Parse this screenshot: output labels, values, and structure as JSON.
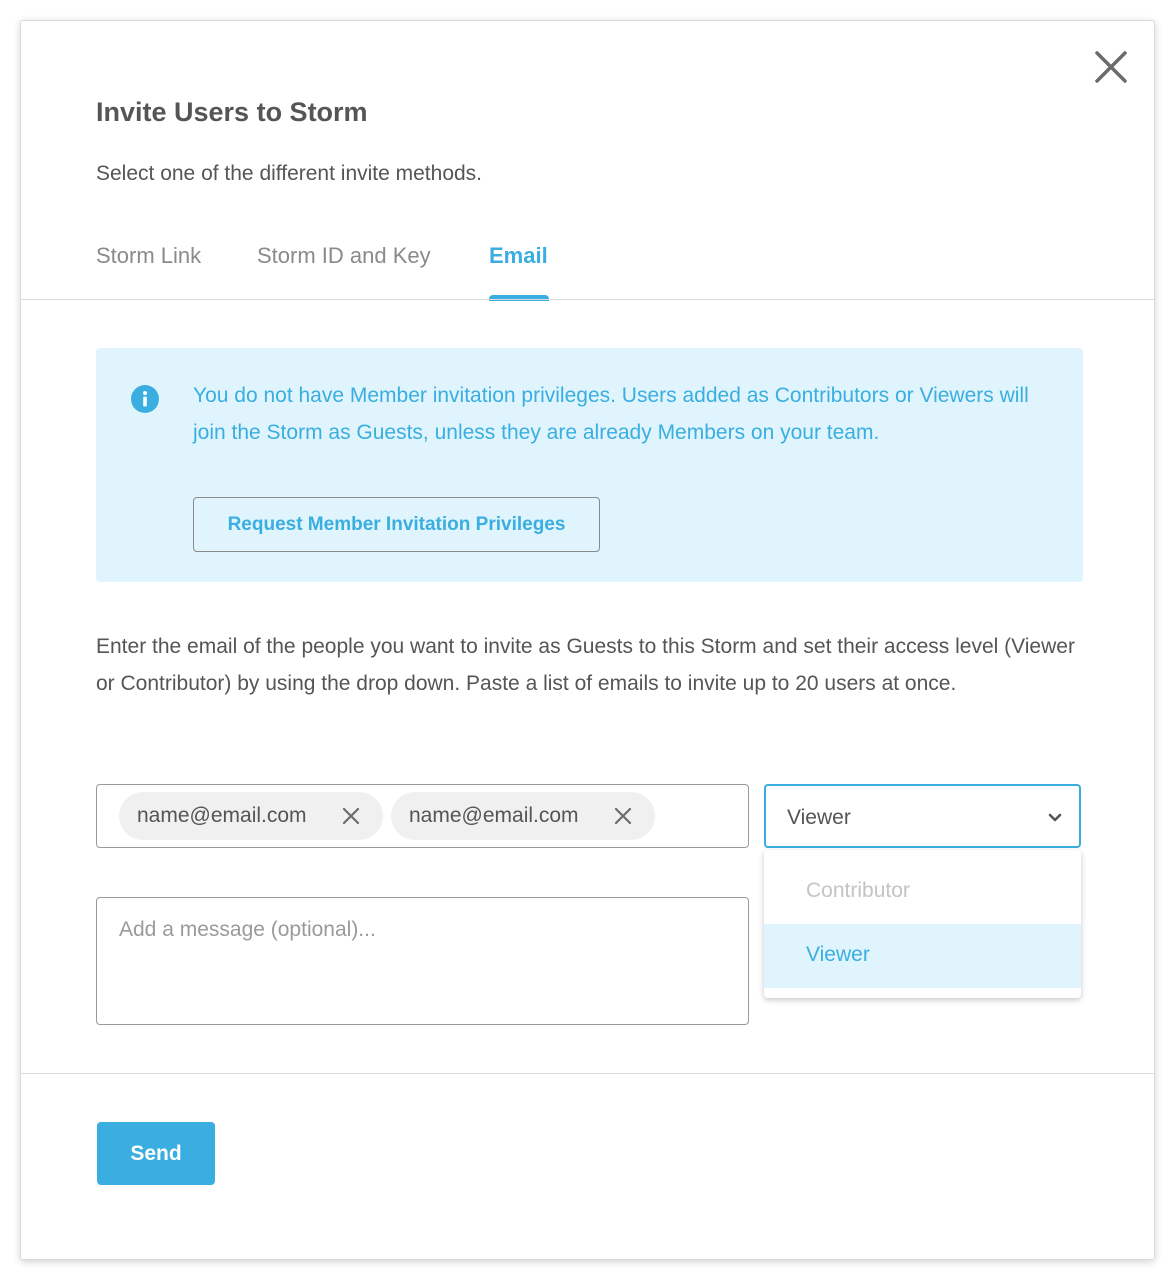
{
  "modal": {
    "title": "Invite Users to Storm",
    "subtitle": "Select one of the different invite methods."
  },
  "tabs": [
    {
      "label": "Storm Link",
      "active": false
    },
    {
      "label": "Storm ID and Key",
      "active": false
    },
    {
      "label": "Email",
      "active": true
    }
  ],
  "info": {
    "icon": "info-icon",
    "text": "You do not have Member invitation privileges. Users added as Contributors or Viewers will join the Storm as Guests, unless they are already Members on your team.",
    "button_label": "Request Member Invitation Privileges"
  },
  "description": "Enter the email of the people you want to invite as Guests to this Storm and set their access level (Viewer or Contributor) by using the drop down. Paste a list of emails to invite up to 20 users at once.",
  "email_chips": [
    {
      "email": "name@email.com"
    },
    {
      "email": "name@email.com"
    }
  ],
  "access_select": {
    "value": "Viewer",
    "options": [
      {
        "label": "Contributor",
        "selected": false
      },
      {
        "label": "Viewer",
        "selected": true
      }
    ]
  },
  "message": {
    "placeholder": "Add a message (optional)...",
    "value": ""
  },
  "footer": {
    "send_label": "Send"
  },
  "colors": {
    "accent": "#3aaee0",
    "info_bg": "#dff4fc",
    "text": "#555555",
    "muted": "#8a8a8a"
  }
}
